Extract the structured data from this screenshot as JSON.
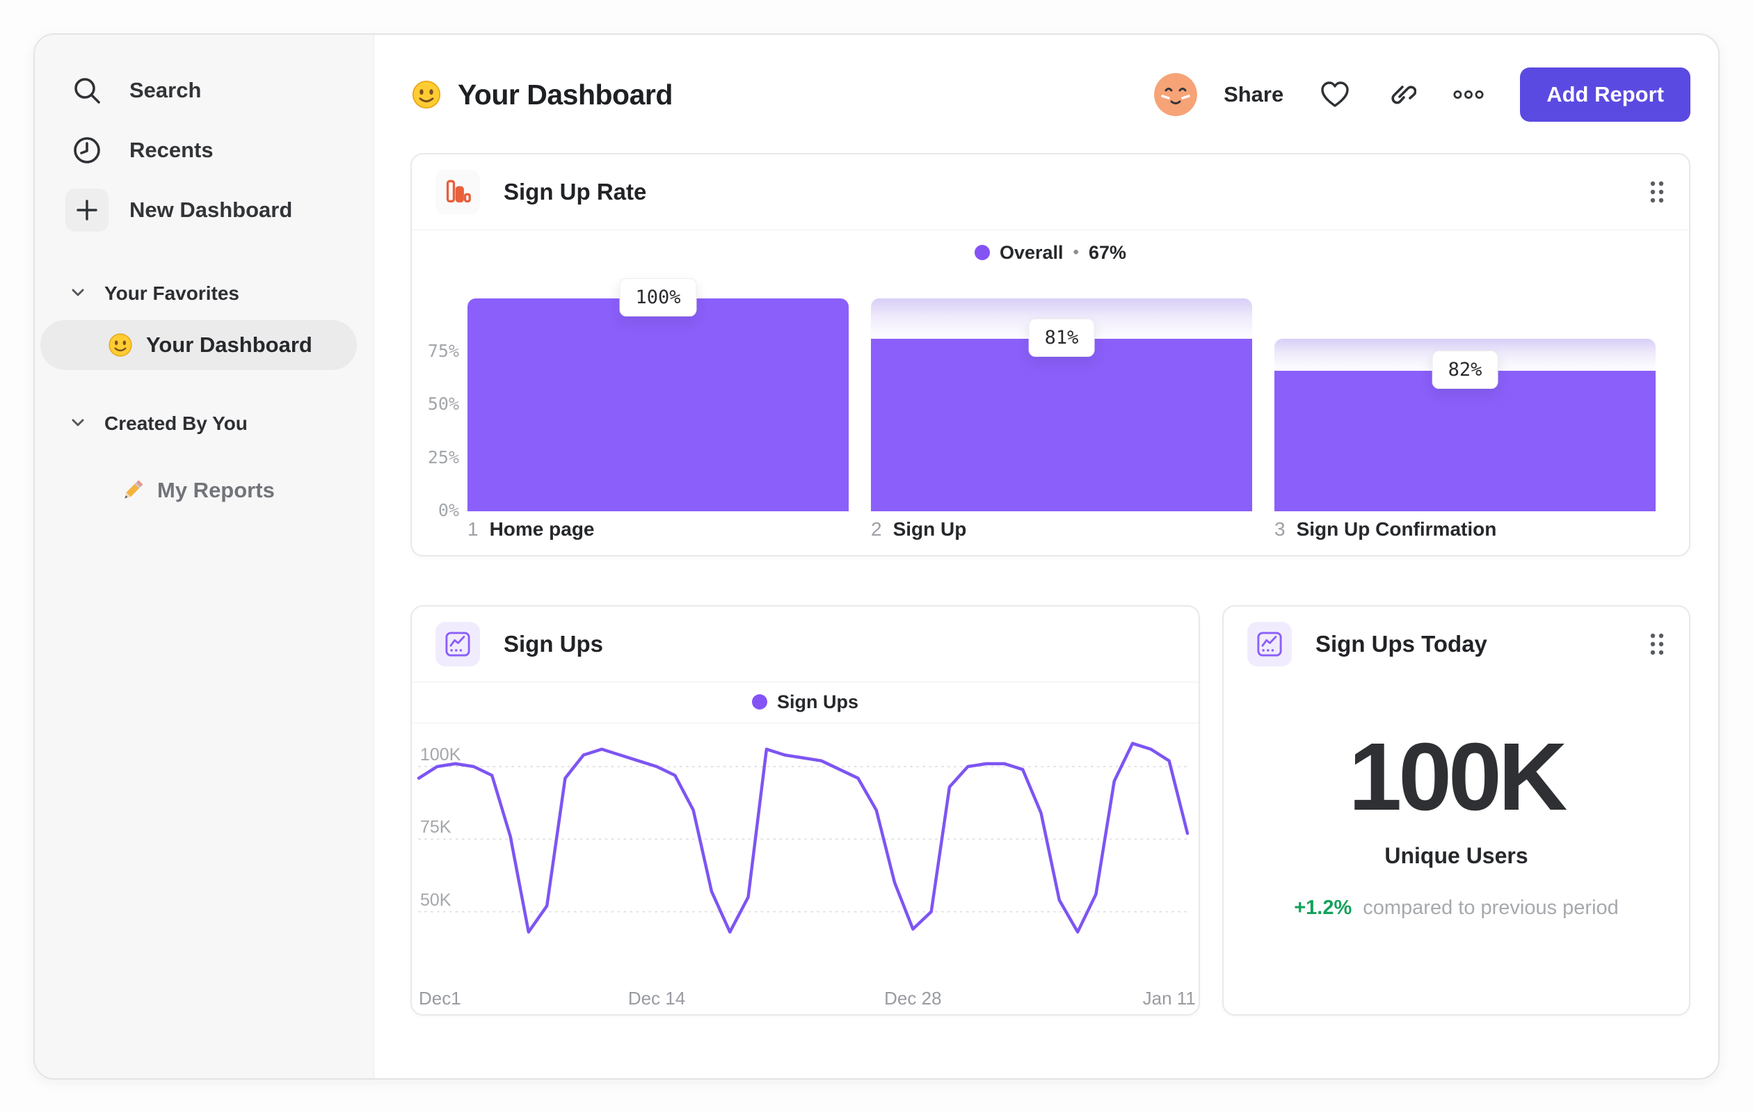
{
  "sidebar": {
    "items": [
      {
        "icon": "search",
        "label": "Search"
      },
      {
        "icon": "clock",
        "label": "Recents"
      },
      {
        "icon": "plus",
        "label": "New Dashboard"
      }
    ],
    "sections": [
      {
        "label": "Your Favorites",
        "item": {
          "icon": "smiley",
          "label": "Your Dashboard",
          "selected": true
        }
      },
      {
        "label": "Created By You",
        "item": {
          "icon": "pencil",
          "label": "My Reports",
          "selected": false
        }
      }
    ]
  },
  "header": {
    "title": "Your Dashboard",
    "share_label": "Share",
    "add_report_label": "Add Report"
  },
  "funnel_card": {
    "title": "Sign Up Rate",
    "legend_label": "Overall",
    "legend_sep": "•",
    "legend_value": "67%",
    "y_ticks": [
      "75%",
      "50%",
      "25%",
      "0%"
    ],
    "steps": [
      {
        "num": "1",
        "label": "Home page",
        "tooltip": "100%"
      },
      {
        "num": "2",
        "label": "Sign Up",
        "tooltip": "81%"
      },
      {
        "num": "3",
        "label": "Sign Up Confirmation",
        "tooltip": "82%"
      }
    ]
  },
  "line_card": {
    "title": "Sign Ups",
    "legend_label": "Sign Ups",
    "y_ticks": [
      "100K",
      "75K",
      "50K"
    ],
    "x_ticks": [
      "Dec1",
      "Dec 14",
      "Dec 28",
      "Jan 11"
    ]
  },
  "today_card": {
    "title": "Sign Ups Today",
    "value": "100K",
    "subtitle": "Unique Users",
    "delta": "+1.2%",
    "delta_note": "compared to previous period"
  },
  "colors": {
    "accent_purple": "#8a5ffa",
    "line_purple": "#7d55f2",
    "button_indigo": "#5b4ae1",
    "funnel_icon_orange": "#e8603c",
    "positive_green": "#13a15c",
    "sidebar_bg": "#f7f7f8"
  },
  "chart_data": [
    {
      "type": "bar",
      "subtype": "funnel",
      "title": "Sign Up Rate",
      "legend": "Overall • 67%",
      "overall_conversion_pct": 67,
      "categories": [
        "Home page",
        "Sign Up",
        "Sign Up Confirmation"
      ],
      "step_conversion_pct": [
        100,
        81,
        82
      ],
      "cumulative_pct": [
        100,
        81,
        66
      ],
      "ylim": [
        0,
        100
      ],
      "y_ticks_pct": [
        75,
        50,
        25,
        0
      ]
    },
    {
      "type": "line",
      "title": "Sign Ups",
      "legend": "Sign Ups",
      "x_tick_labels": [
        "Dec1",
        "Dec 14",
        "Dec 28",
        "Jan 11"
      ],
      "x_tick_indices": [
        0,
        13,
        27,
        41
      ],
      "y_gridlines_thousands": [
        100,
        75,
        50
      ],
      "ylim_thousands": [
        30,
        112
      ],
      "series": [
        {
          "name": "Sign Ups",
          "values_thousands": [
            96,
            100,
            101,
            100,
            97,
            76,
            43,
            52,
            96,
            104,
            106,
            104,
            102,
            100,
            97,
            85,
            57,
            43,
            55,
            106,
            104,
            103,
            102,
            99,
            96,
            85,
            60,
            44,
            50,
            93,
            100,
            101,
            101,
            99,
            84,
            54,
            43,
            56,
            95,
            108,
            106,
            102,
            77
          ]
        }
      ]
    }
  ]
}
